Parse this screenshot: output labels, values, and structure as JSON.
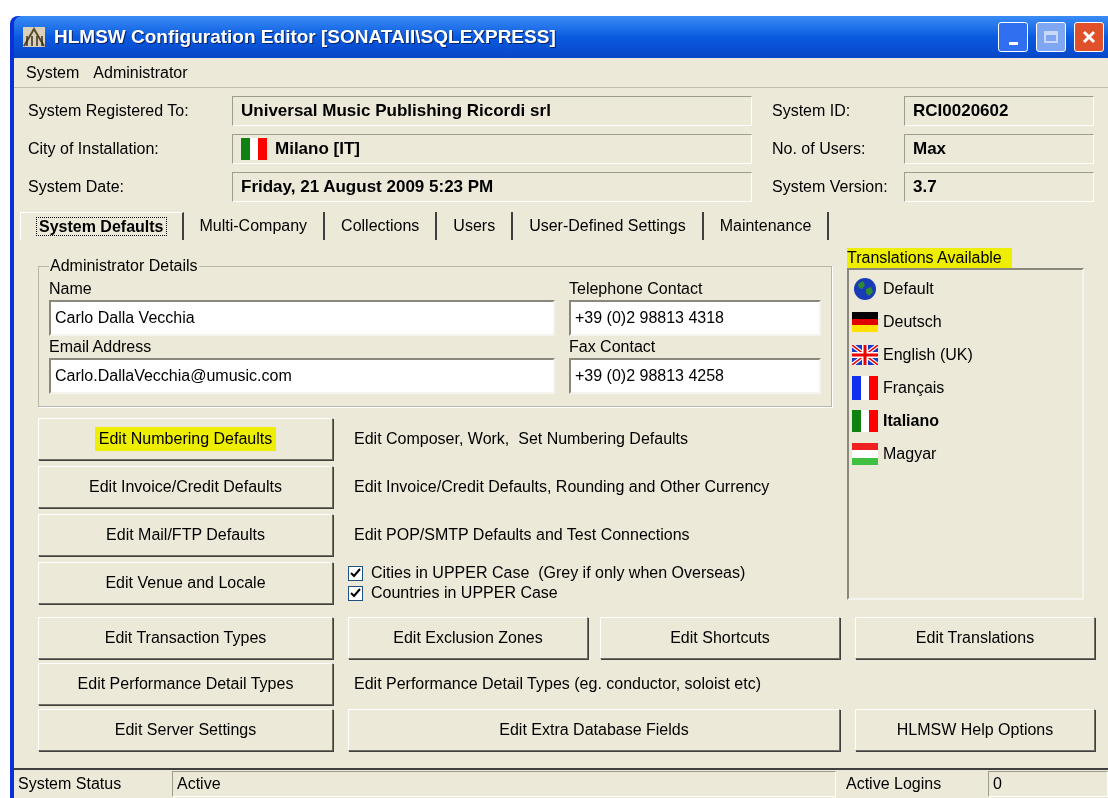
{
  "window": {
    "title": "HLMSW Configuration Editor [SONATAII\\SQLEXPRESS]",
    "maximize_disabled": true
  },
  "menu": [
    {
      "label": "System"
    },
    {
      "label": "Administrator"
    }
  ],
  "info": [
    {
      "label": "System Registered To:",
      "value": "Universal Music Publishing Ricordi srl"
    },
    {
      "label": "City of Installation:",
      "value": "Milano [IT]",
      "kind": "it"
    },
    {
      "label": "System Date:",
      "value": "Friday, 21 August 2009 5:23 PM"
    }
  ],
  "info_right": [
    {
      "label": "System ID:",
      "value": "RCI0020602"
    },
    {
      "label": "No. of Users:",
      "value": "Max"
    },
    {
      "label": "System Version:",
      "value": "3.7"
    }
  ],
  "tabs": [
    {
      "label": "System Defaults",
      "selected": true
    },
    {
      "label": "Multi-Company",
      "selected": false
    },
    {
      "label": "Collections",
      "selected": false
    },
    {
      "label": "Users",
      "selected": false
    },
    {
      "label": "User-Defined Settings",
      "selected": false
    },
    {
      "label": "Maintenance",
      "selected": false
    }
  ],
  "admin": {
    "title": "Administrator Details",
    "fields": [
      {
        "label": "Name",
        "value": "Carlo Dalla Vecchia"
      },
      {
        "label": "Telephone Contact",
        "value": "+39 (0)2 98813 4318"
      },
      {
        "label": "Email Address",
        "value": "Carlo.DallaVecchia@umusic.com"
      },
      {
        "label": "Fax Contact",
        "value": "+39 (0)2 98813 4258"
      }
    ]
  },
  "translations": {
    "title": "Translations Available",
    "highlighted": true,
    "items": [
      {
        "label": "Default",
        "kind": "globe",
        "selected": false
      },
      {
        "label": "Deutsch",
        "kind": "de",
        "selected": false
      },
      {
        "label": "English (UK)",
        "kind": "gb",
        "selected": false
      },
      {
        "label": "Français",
        "kind": "fr",
        "selected": false
      },
      {
        "label": "Italiano",
        "kind": "it",
        "selected": true
      },
      {
        "label": "Magyar",
        "kind": "hu",
        "selected": false
      }
    ]
  },
  "upper_rows": [
    {
      "kind": "description",
      "button": {
        "label": "Edit Numbering Defaults",
        "highlighted": true
      },
      "description": "Edit Composer, Work,  Set Numbering Defaults"
    },
    {
      "kind": "description",
      "button": {
        "label": "Edit Invoice/Credit Defaults",
        "highlighted": false
      },
      "description": "Edit Invoice/Credit Defaults, Rounding and Other Currency"
    },
    {
      "kind": "description",
      "button": {
        "label": "Edit Mail/FTP Defaults",
        "highlighted": false
      },
      "description": "Edit POP/SMTP Defaults and Test Connections"
    },
    {
      "kind": "checkboxes",
      "button": {
        "label": "Edit Venue and Locale",
        "highlighted": false
      },
      "checkboxes": [
        {
          "label": "Cities in UPPER Case  (Grey if only when Overseas)",
          "checked": true
        },
        {
          "label": "Countries in UPPER Case",
          "checked": true
        }
      ]
    }
  ],
  "lower_rows": [
    {
      "kind": "buttons",
      "button": {
        "label": "Edit Transaction Types"
      },
      "buttons": [
        {
          "label": "Edit Exclusion Zones"
        },
        {
          "label": "Edit Shortcuts"
        }
      ],
      "right_button": {
        "label": "Edit Translations"
      }
    },
    {
      "kind": "description",
      "button": {
        "label": "Edit Performance Detail Types"
      },
      "description": "Edit Performance Detail Types (eg. conductor, soloist etc)"
    },
    {
      "kind": "buttons",
      "button": {
        "label": "Edit Server Settings"
      },
      "buttons": [
        {
          "label": "Edit Extra Database Fields"
        }
      ],
      "right_button": {
        "label": "HLMSW Help Options"
      }
    }
  ],
  "status_bar": {
    "status_label": "System Status",
    "status_value": "Active",
    "logins_label": "Active Logins",
    "logins_value": "0"
  }
}
